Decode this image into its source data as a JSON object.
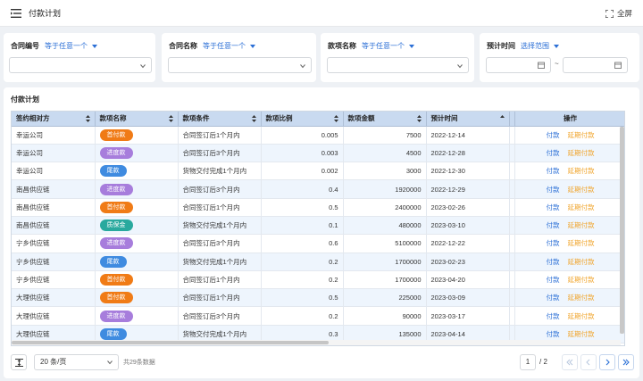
{
  "header": {
    "title": "付款计划",
    "fullscreen_label": "全屏"
  },
  "filters": [
    {
      "label": "合同编号",
      "op": "等于任意一个"
    },
    {
      "label": "合同名称",
      "op": "等于任意一个"
    },
    {
      "label": "款项名称",
      "op": "等于任意一个"
    },
    {
      "label": "预计时间",
      "op": "选择范围"
    }
  ],
  "date_separator": "~",
  "panel": {
    "title": "付款计划"
  },
  "table": {
    "columns": [
      "签约相对方",
      "款项名称",
      "款项条件",
      "款项比例",
      "款项金额",
      "预计时间",
      "",
      "操作"
    ],
    "rows": [
      {
        "party": "幸运公司",
        "item": "首付款",
        "tag": "first",
        "cond": "合同签订后1个月内",
        "ratio": "0.005",
        "amount": "7500",
        "date": "2022-12-14"
      },
      {
        "party": "幸运公司",
        "item": "进度款",
        "tag": "progress",
        "cond": "合同签订后3个月内",
        "ratio": "0.003",
        "amount": "4500",
        "date": "2022-12-28"
      },
      {
        "party": "幸运公司",
        "item": "尾款",
        "tag": "final",
        "cond": "货物交付完成1个月内",
        "ratio": "0.002",
        "amount": "3000",
        "date": "2022-12-30"
      },
      {
        "party": "南昌供应链",
        "item": "进度款",
        "tag": "progress",
        "cond": "合同签订后3个月内",
        "ratio": "0.4",
        "amount": "1920000",
        "date": "2022-12-29"
      },
      {
        "party": "南昌供应链",
        "item": "首付款",
        "tag": "first",
        "cond": "合同签订后1个月内",
        "ratio": "0.5",
        "amount": "2400000",
        "date": "2023-02-26"
      },
      {
        "party": "南昌供应链",
        "item": "质保金",
        "tag": "quality",
        "cond": "货物交付完成1个月内",
        "ratio": "0.1",
        "amount": "480000",
        "date": "2023-03-10"
      },
      {
        "party": "宁乡供应链",
        "item": "进度款",
        "tag": "progress",
        "cond": "合同签订后3个月内",
        "ratio": "0.6",
        "amount": "5100000",
        "date": "2022-12-22"
      },
      {
        "party": "宁乡供应链",
        "item": "尾款",
        "tag": "final",
        "cond": "货物交付完成1个月内",
        "ratio": "0.2",
        "amount": "1700000",
        "date": "2023-02-23"
      },
      {
        "party": "宁乡供应链",
        "item": "首付款",
        "tag": "first",
        "cond": "合同签订后1个月内",
        "ratio": "0.2",
        "amount": "1700000",
        "date": "2023-04-20"
      },
      {
        "party": "大理供应链",
        "item": "首付款",
        "tag": "first",
        "cond": "合同签订后1个月内",
        "ratio": "0.5",
        "amount": "225000",
        "date": "2023-03-09"
      },
      {
        "party": "大理供应链",
        "item": "进度款",
        "tag": "progress",
        "cond": "合同签订后3个月内",
        "ratio": "0.2",
        "amount": "90000",
        "date": "2023-03-17"
      },
      {
        "party": "大理供应链",
        "item": "尾款",
        "tag": "final",
        "cond": "货物交付完成1个月内",
        "ratio": "0.3",
        "amount": "135000",
        "date": "2023-04-14"
      }
    ],
    "action_pay": "付款",
    "action_delay": "延期付款"
  },
  "pager": {
    "page_size": "20 条/页",
    "total_text": "共29条数据",
    "current_page": "1",
    "total_pages": "/ 2"
  },
  "colors": {
    "accent": "#2b6fd6",
    "tag_first": "#f07b16",
    "tag_progress": "#a77ddc",
    "tag_final": "#3f8be0",
    "tag_quality": "#29a99e",
    "delay_link": "#f0a52d"
  }
}
